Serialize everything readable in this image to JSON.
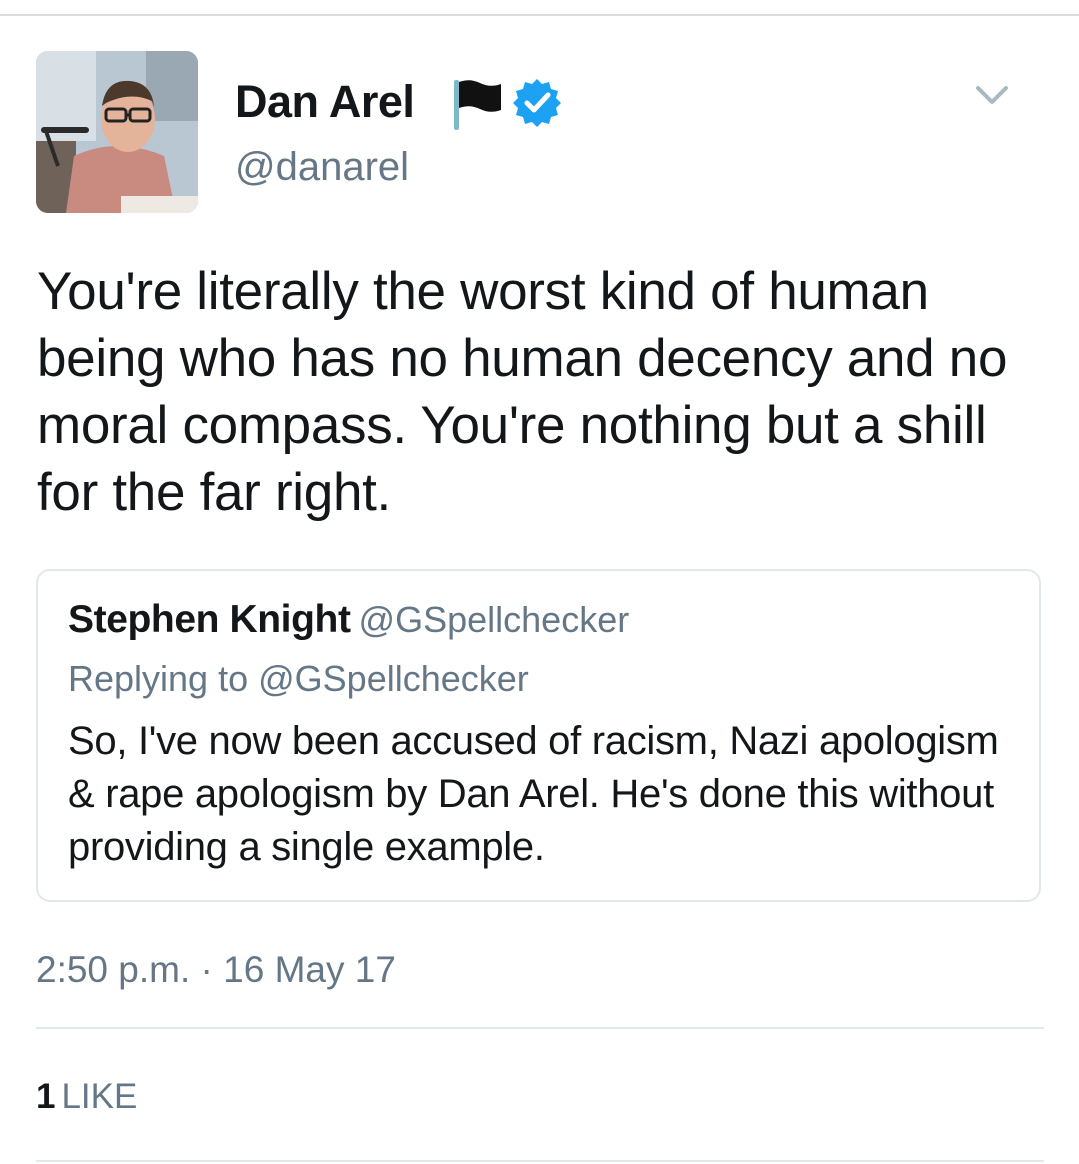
{
  "tweet": {
    "author": {
      "display_name": "Dan Arel",
      "handle": "@danarel",
      "flag_emoji_icon": "black-flag-icon",
      "verified_icon": "verified-badge-icon",
      "verified_color": "#1da1f2"
    },
    "text": "You're literally the worst kind of human being who has no human decency and no moral compass. You're nothing but a shill for the far right.",
    "menu_icon": "chevron-down-icon",
    "quoted_tweet": {
      "display_name": "Stephen Knight",
      "handle": "@GSpellchecker",
      "replying_to": "Replying to @GSpellchecker",
      "text": "So, I've now been accused of racism, Nazi apologism & rape apologism by Dan Arel. He's done this without providing a single example."
    },
    "timestamp": "2:50 p.m. · 16 May 17",
    "likes": {
      "count": "1",
      "label": "LIKE"
    }
  },
  "colors": {
    "text_primary": "#14171a",
    "text_secondary": "#657786",
    "border": "#e1e8ed"
  }
}
